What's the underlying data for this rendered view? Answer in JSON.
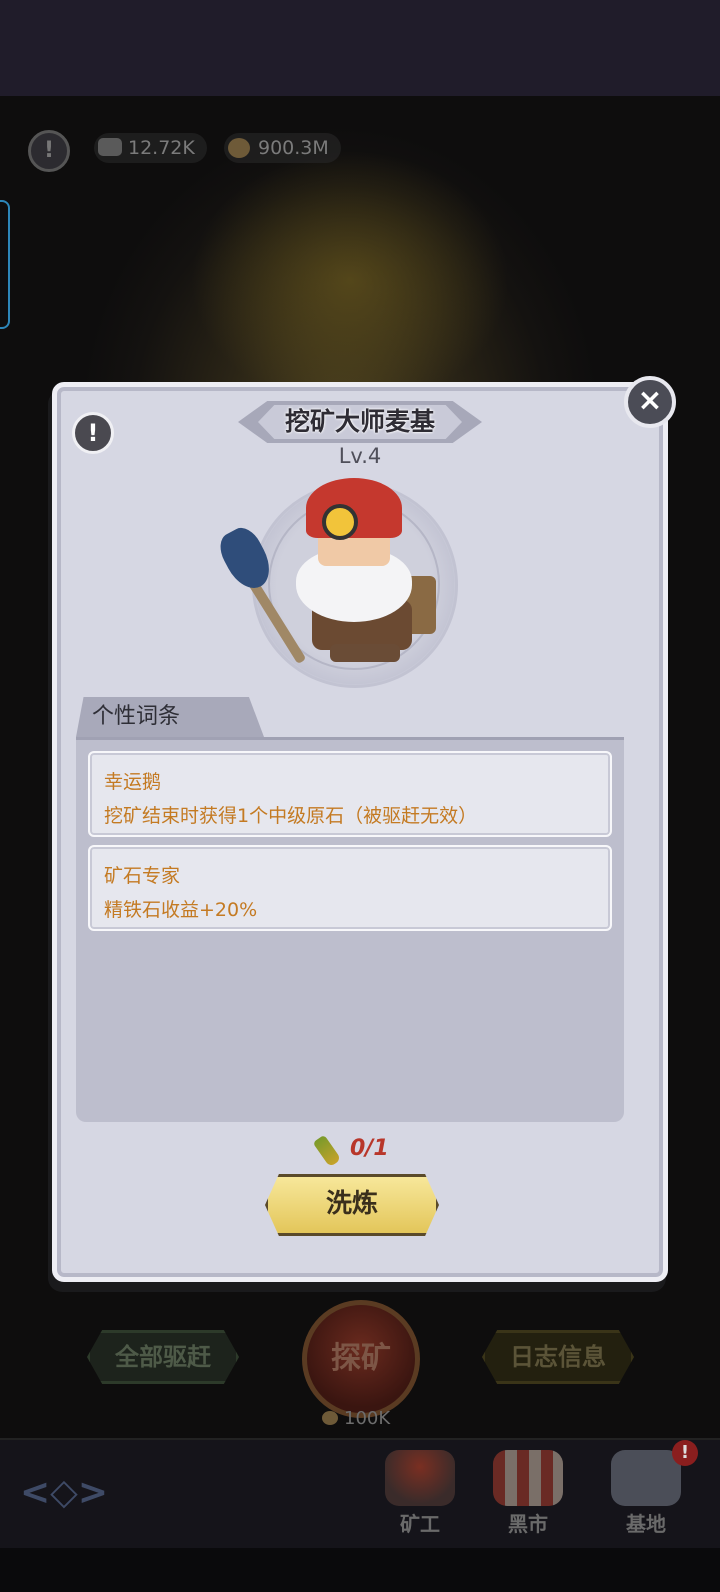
{
  "hud": {
    "ore_count": "12.72K",
    "coin_count": "900.3M",
    "warn_icon": "exclamation-icon"
  },
  "dialog": {
    "title": "挖矿大师麦基",
    "level": "Lv.4",
    "traits_header": "个性词条",
    "traits": [
      {
        "name": "幸运鹅",
        "desc": "挖矿结束时获得1个中级原石（被驱赶无效）"
      },
      {
        "name": "矿石专家",
        "desc": "精铁石收益+20%"
      }
    ],
    "refine_cost": "0/1",
    "refine_label": "洗炼",
    "close_icon": "close-icon"
  },
  "bottom": {
    "drive_all_label": "全部驱赶",
    "explore_label": "探矿",
    "explore_cost": "100K",
    "log_label": "日志信息"
  },
  "nav": {
    "miner_label": "矿工",
    "market_label": "黑市",
    "base_label": "基地",
    "base_badge": "!"
  },
  "colors": {
    "trait_text": "#c47a22",
    "cost_text": "#b8362a",
    "refine_button": "#e3c65a",
    "dialog_bg": "#d6d7e3"
  }
}
